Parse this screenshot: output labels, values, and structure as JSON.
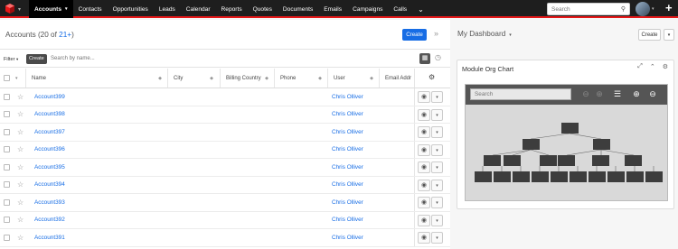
{
  "nav": {
    "items": [
      "Accounts",
      "Contacts",
      "Opportunities",
      "Leads",
      "Calendar",
      "Reports",
      "Quotes",
      "Documents",
      "Emails",
      "Campaigns",
      "Calls"
    ],
    "active": "Accounts",
    "search_placeholder": "Search"
  },
  "list": {
    "title_prefix": "Accounts (20 of ",
    "title_link": "21+",
    "title_suffix": ")",
    "create_label": "Create",
    "filter_label": "Filter",
    "filter_create_label": "Create",
    "search_placeholder": "Search by name...",
    "columns": [
      "Name",
      "City",
      "Billing Country",
      "Phone",
      "User",
      "Email Address"
    ],
    "rows": [
      {
        "name": "Account399",
        "user": "Chris Olliver"
      },
      {
        "name": "Account398",
        "user": "Chris Olliver"
      },
      {
        "name": "Account397",
        "user": "Chris Olliver"
      },
      {
        "name": "Account396",
        "user": "Chris Olliver"
      },
      {
        "name": "Account395",
        "user": "Chris Olliver"
      },
      {
        "name": "Account394",
        "user": "Chris Olliver"
      },
      {
        "name": "Account393",
        "user": "Chris Olliver"
      },
      {
        "name": "Account392",
        "user": "Chris Olliver"
      },
      {
        "name": "Account391",
        "user": "Chris Olliver"
      }
    ]
  },
  "dashboard": {
    "title": "My Dashboard",
    "create_label": "Create",
    "dashlet_title": "Module Org Chart",
    "org_search_placeholder": "Search"
  },
  "colors": {
    "accent": "#176de5",
    "topbar": "#1e1e1e",
    "brand_red": "#e61718"
  }
}
